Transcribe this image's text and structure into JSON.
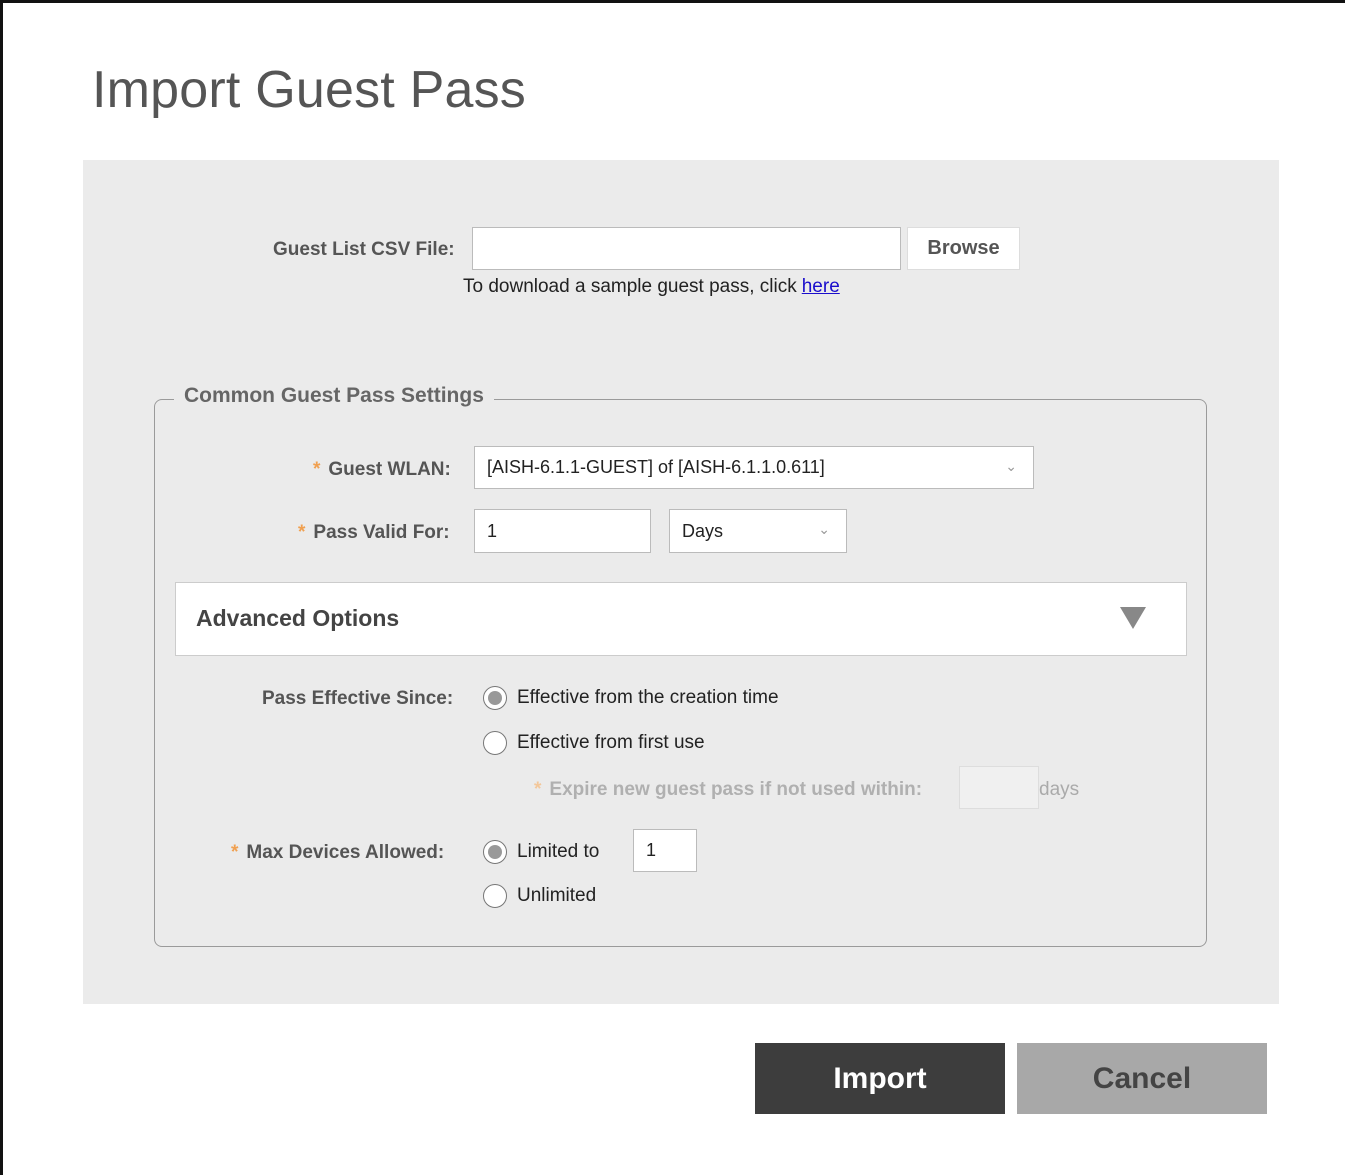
{
  "page": {
    "title": "Import Guest Pass"
  },
  "csv": {
    "label": "Guest List CSV File:",
    "value": "",
    "browse_label": "Browse",
    "hint_text": "To download a sample guest pass, click",
    "hint_link": "here"
  },
  "settings": {
    "legend": "Common Guest Pass Settings",
    "required_mark": "*",
    "guest_wlan": {
      "label": "Guest WLAN:",
      "value": "[AISH-6.1.1-GUEST] of [AISH-6.1.1.0.611]"
    },
    "pass_valid": {
      "label": "Pass Valid For:",
      "value": "1",
      "unit": "Days"
    }
  },
  "advanced": {
    "title": "Advanced Options",
    "effective_since": {
      "label": "Pass Effective Since:",
      "options": [
        {
          "label": "Effective from the creation time",
          "checked": true
        },
        {
          "label": "Effective from first use",
          "checked": false
        }
      ],
      "expire_label": "Expire new guest pass if not used within:",
      "expire_value": "",
      "expire_unit": "days"
    },
    "max_devices": {
      "label": "Max Devices Allowed:",
      "options": [
        {
          "label": "Limited to",
          "checked": true
        },
        {
          "label": "Unlimited",
          "checked": false
        }
      ],
      "limit_value": "1"
    }
  },
  "actions": {
    "import_label": "Import",
    "cancel_label": "Cancel"
  },
  "colors": {
    "required": "#f0a050",
    "import_bg": "#3d3d3d",
    "cancel_bg": "#a8a8a8",
    "panel_bg": "#ebebeb"
  }
}
